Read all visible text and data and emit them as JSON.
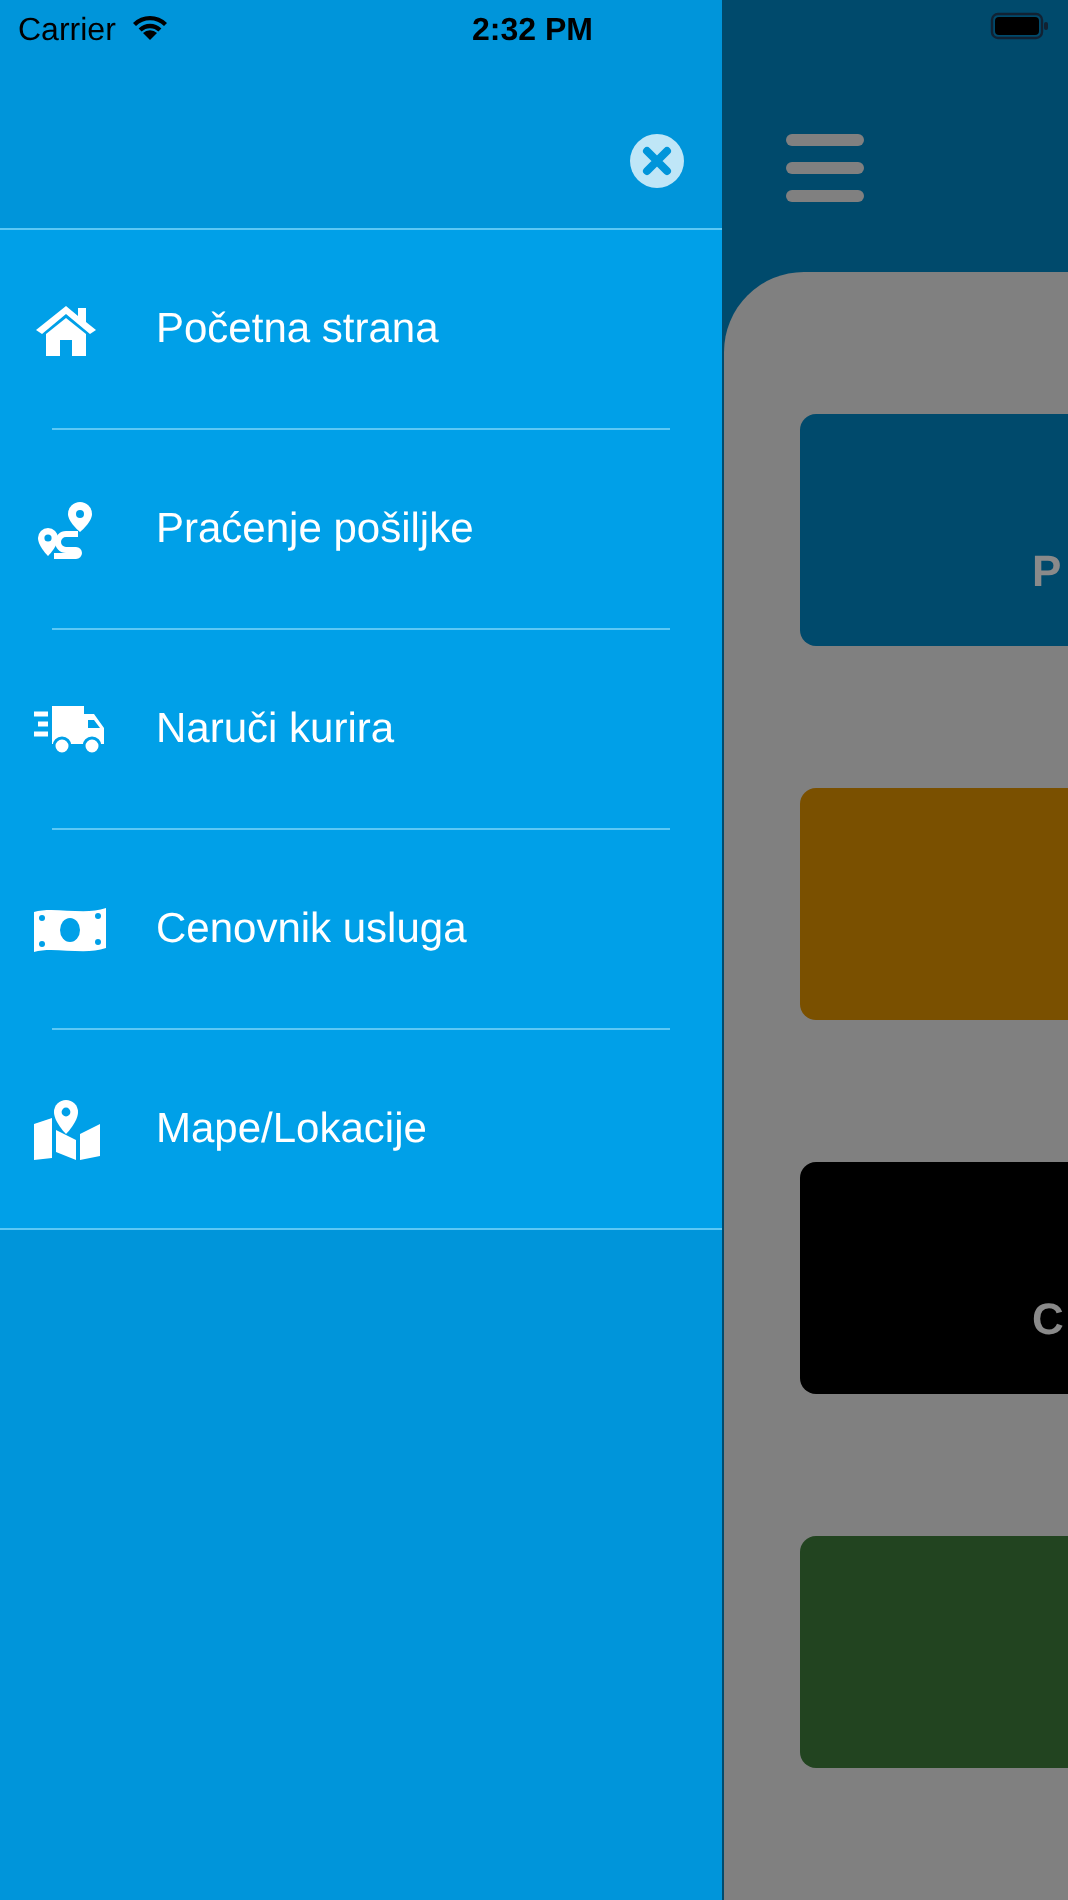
{
  "status_bar": {
    "carrier": "Carrier",
    "time": "2:32 PM"
  },
  "drawer": {
    "menu_items": [
      {
        "kind": "home",
        "label": "Početna strana"
      },
      {
        "kind": "route",
        "label": "Praćenje pošiljke"
      },
      {
        "kind": "truck",
        "label": "Naruči kurira"
      },
      {
        "kind": "money",
        "label": "Cenovnik usluga"
      },
      {
        "kind": "map",
        "label": "Mape/Lokacije"
      }
    ]
  },
  "background_cards": [
    {
      "color": "#004a6c",
      "label": "P"
    },
    {
      "color": "#7a5000"
    },
    {
      "color": "#000000",
      "label": "C"
    },
    {
      "color": "#224420"
    }
  ]
}
